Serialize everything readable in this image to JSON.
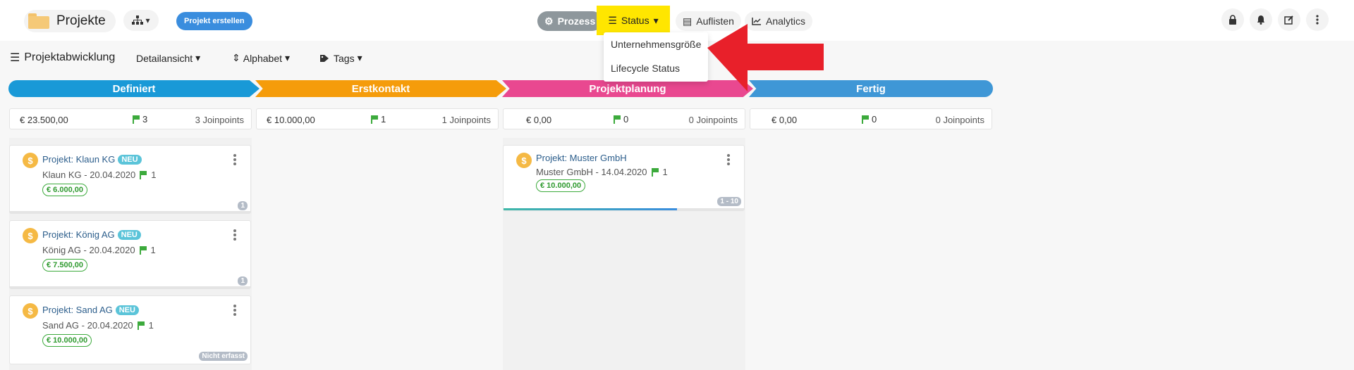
{
  "header": {
    "title": "Projekte",
    "create_button": "Projekt erstellen",
    "nav": {
      "prozess": "Prozess",
      "status": "Status",
      "auflisten": "Auflisten",
      "analytics": "Analytics"
    },
    "status_dropdown": [
      "Unternehmensgröße",
      "Lifecycle Status"
    ]
  },
  "toolbar": {
    "view_title": "Projektabwicklung",
    "detail": "Detailansicht",
    "sort": "Alphabet",
    "tags": "Tags"
  },
  "phases": [
    {
      "label": "Definiert",
      "color": "#1999d7"
    },
    {
      "label": "Erstkontakt",
      "color": "#f59c0b"
    },
    {
      "label": "Projektplanung",
      "color": "#e94890"
    },
    {
      "label": "Fertig",
      "color": "#3f97d6"
    }
  ],
  "summaries": [
    {
      "amount": "€ 23.500,00",
      "count": "3",
      "joinpoints": "3 Joinpoints"
    },
    {
      "amount": "€ 10.000,00",
      "count": "1",
      "joinpoints": "1 Joinpoints"
    },
    {
      "amount": "€ 0,00",
      "count": "0",
      "joinpoints": "0 Joinpoints"
    },
    {
      "amount": "€ 0,00",
      "count": "0",
      "joinpoints": "0 Joinpoints"
    }
  ],
  "cards": {
    "klaun": {
      "title": "Projekt: Klaun KG",
      "tag": "NEU",
      "sub": "Klaun KG - 20.04.2020",
      "flags": "1",
      "price": "€ 6.000,00",
      "badge": "1"
    },
    "koenig": {
      "title": "Projekt: König AG",
      "tag": "NEU",
      "sub": "König AG - 20.04.2020",
      "flags": "1",
      "price": "€ 7.500,00",
      "badge": "1"
    },
    "sand": {
      "title": "Projekt: Sand AG",
      "tag": "NEU",
      "sub": "Sand AG - 20.04.2020",
      "flags": "1",
      "price": "€ 10.000,00",
      "badge": "Nicht erfasst"
    },
    "muster": {
      "title": "Projekt: Muster GmbH",
      "sub": "Muster GmbH - 14.04.2020",
      "flags": "1",
      "price": "€ 10.000,00",
      "badge": "1 - 10",
      "progress": 0.72
    }
  },
  "colors": {
    "accent": "#3a8dde",
    "highlight": "#ffe600",
    "arrow": "#e8202a",
    "success": "#3caa3c"
  }
}
